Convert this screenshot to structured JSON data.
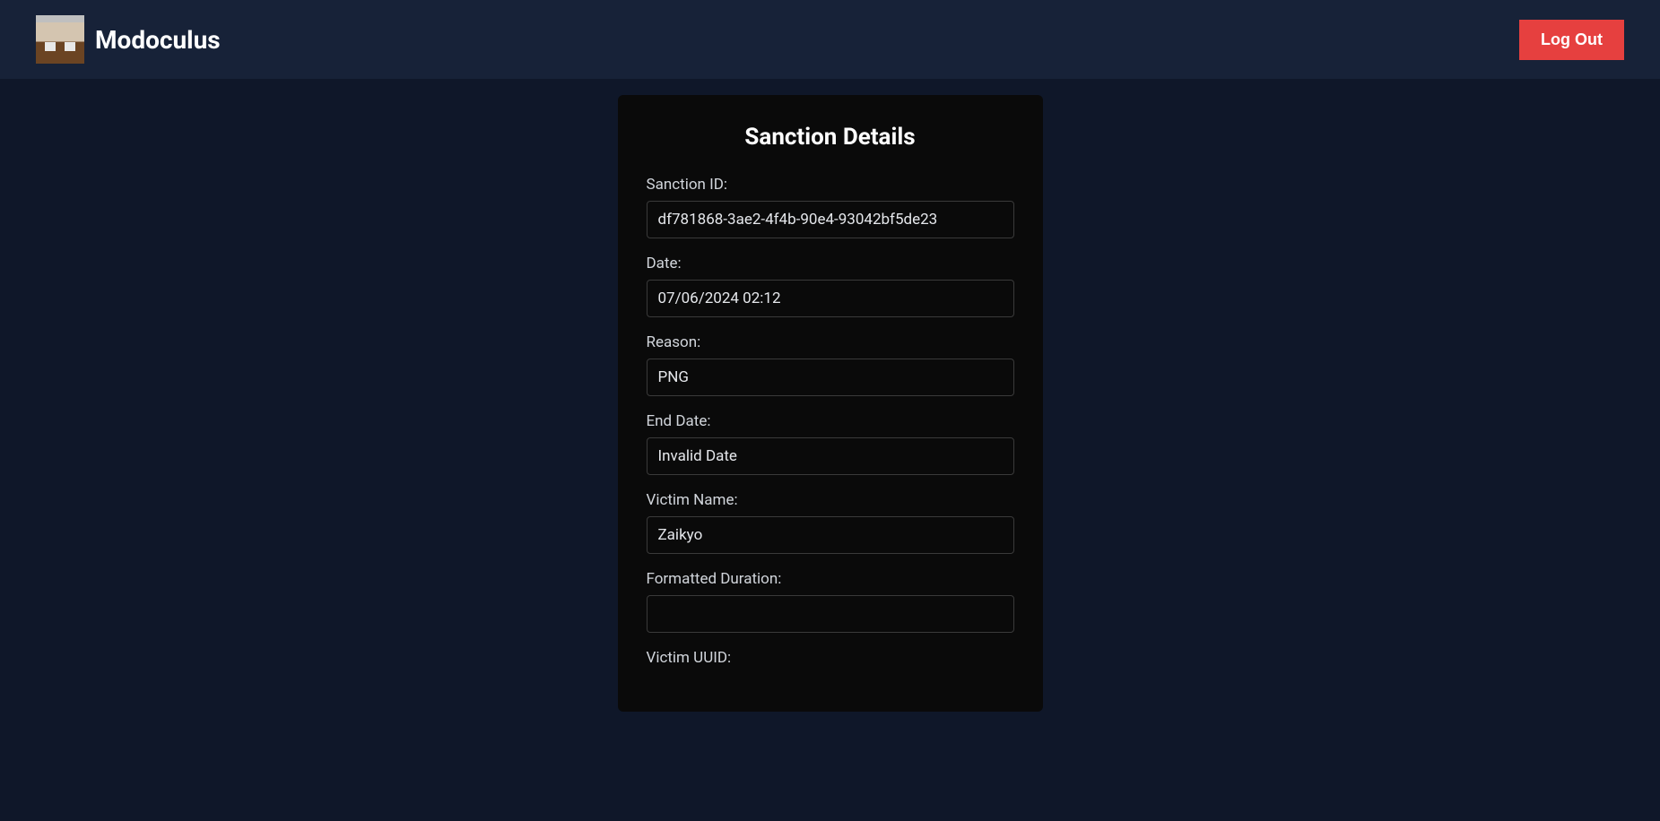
{
  "header": {
    "brand_name": "Modoculus",
    "logout_label": "Log Out"
  },
  "card": {
    "title": "Sanction Details",
    "fields": {
      "sanction_id": {
        "label": "Sanction ID:",
        "value": "df781868-3ae2-4f4b-90e4-93042bf5de23"
      },
      "date": {
        "label": "Date:",
        "value": "07/06/2024 02:12"
      },
      "reason": {
        "label": "Reason:",
        "value": "PNG"
      },
      "end_date": {
        "label": "End Date:",
        "value": "Invalid Date"
      },
      "victim_name": {
        "label": "Victim Name:",
        "value": "Zaikyo"
      },
      "formatted_duration": {
        "label": "Formatted Duration:",
        "value": ""
      },
      "victim_uuid": {
        "label": "Victim UUID:",
        "value": ""
      }
    }
  }
}
